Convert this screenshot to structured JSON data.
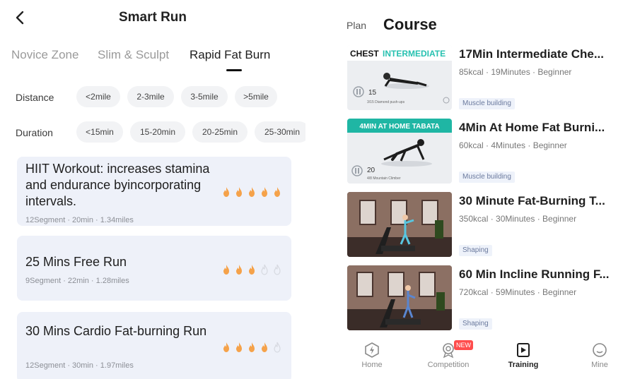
{
  "left": {
    "title": "Smart Run",
    "tabs": [
      {
        "label": "Novice Zone",
        "active": false
      },
      {
        "label": "Slim & Sculpt",
        "active": false
      },
      {
        "label": "Rapid Fat Burn",
        "active": true
      }
    ],
    "filters": {
      "distance": {
        "label": "Distance",
        "options": [
          "<2mile",
          "2-3mile",
          "3-5mile",
          ">5mile"
        ]
      },
      "duration": {
        "label": "Duration",
        "options": [
          "<15min",
          "15-20min",
          "20-25min",
          "25-30min"
        ]
      }
    },
    "workouts": [
      {
        "title": "HIIT Workout:  increases stamina and endurance byincorporating intervals.",
        "meta": "12Segment · 20min · 1.34miles",
        "intensity": 5,
        "max": 5
      },
      {
        "title": "25 Mins Free Run",
        "meta": "9Segment · 22min · 1.28miles",
        "intensity": 3,
        "max": 5
      },
      {
        "title": "30 Mins  Cardio Fat-burning Run",
        "meta": "12Segment · 30min · 1.97miles",
        "intensity": 4,
        "max": 5
      }
    ]
  },
  "right": {
    "plan_label": "Plan",
    "course_label": "Course",
    "courses": [
      {
        "title": "17Min Intermediate Che...",
        "meta": "85kcal · 19Minutes · Beginner",
        "tag": "Muscle building",
        "thumb": {
          "banner_a": "CHEST",
          "banner_b": "INTERMEDIATE",
          "count": "15",
          "caption": "3/15 Diamond push-ups"
        }
      },
      {
        "title": "4Min At Home Fat Burni...",
        "meta": "60kcal · 4Minutes · Beginner",
        "tag": "Muscle building",
        "thumb": {
          "banner_a": "4MIN AT HOME TABATA",
          "count": "20",
          "caption": "4/8 Mountain Climber"
        }
      },
      {
        "title": "30 Minute Fat-Burning T...",
        "meta": "350kcal · 30Minutes · Beginner",
        "tag": "Shaping"
      },
      {
        "title": "60 Min Incline Running F...",
        "meta": "720kcal · 59Minutes · Beginner",
        "tag": "Shaping"
      }
    ],
    "nav": [
      {
        "label": "Home",
        "icon": "home-bolt-icon",
        "active": false
      },
      {
        "label": "Competition",
        "icon": "medal-icon",
        "active": false,
        "badge": "NEW"
      },
      {
        "label": "Training",
        "icon": "training-icon",
        "active": true
      },
      {
        "label": "Mine",
        "icon": "profile-icon",
        "active": false
      }
    ]
  },
  "colors": {
    "flame_on": "#f5a24a",
    "flame_off": "#d6d9e0",
    "card_bg": "#eef1f9",
    "chip_bg": "#f2f3f5",
    "badge": "#ff4d4d"
  }
}
